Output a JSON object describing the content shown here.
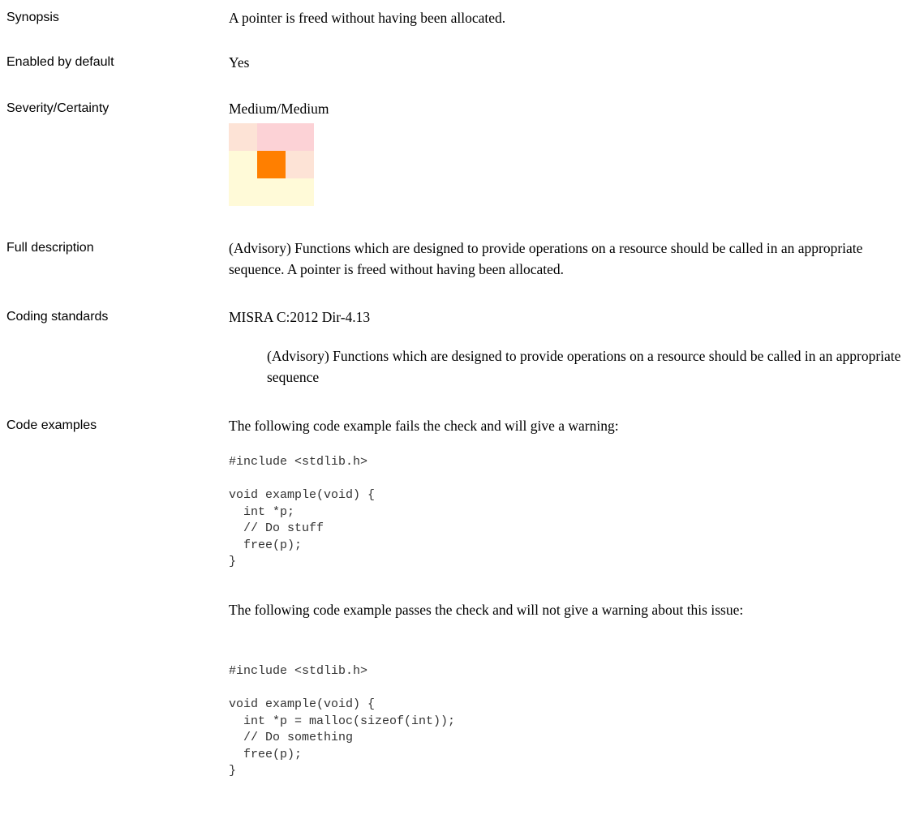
{
  "rows": {
    "synopsis": {
      "label": "Synopsis",
      "value": "A pointer is freed without having been allocated."
    },
    "enabled": {
      "label": "Enabled by default",
      "value": "Yes"
    },
    "severity": {
      "label": "Severity/Certainty",
      "value": "Medium/Medium"
    },
    "full_description": {
      "label": "Full description",
      "value": "(Advisory) Functions which are designed to provide operations on a resource should be called in an appropriate sequence.  A pointer is freed without having been allocated."
    },
    "coding_standards": {
      "label": "Coding standards",
      "value": "MISRA C:2012 Dir-4.13",
      "detail": "(Advisory) Functions which are designed to provide operations on a resource should be called in an appropriate sequence"
    },
    "code_examples": {
      "label": "Code examples",
      "fail_intro": "The following code example fails the check and will give a warning:",
      "fail_code": "#include <stdlib.h>\n\nvoid example(void) {\n  int *p;\n  // Do stuff\n  free(p);\n}",
      "pass_intro": "The following code example passes the check and will not give a warning about this issue:",
      "pass_code": "#include <stdlib.h>\n\nvoid example(void) {\n  int *p = malloc(sizeof(int));\n  // Do something\n  free(p);\n}"
    }
  },
  "severity_matrix": {
    "highlighted": "Medium/Medium",
    "cells": [
      [
        "#fde3d6",
        "#fcd2d6",
        "#fcd2d6"
      ],
      [
        "#fffad8",
        "#ff7f00",
        "#fde3d6"
      ],
      [
        "#fffad8",
        "#fffad8",
        "#fffad8"
      ]
    ]
  }
}
